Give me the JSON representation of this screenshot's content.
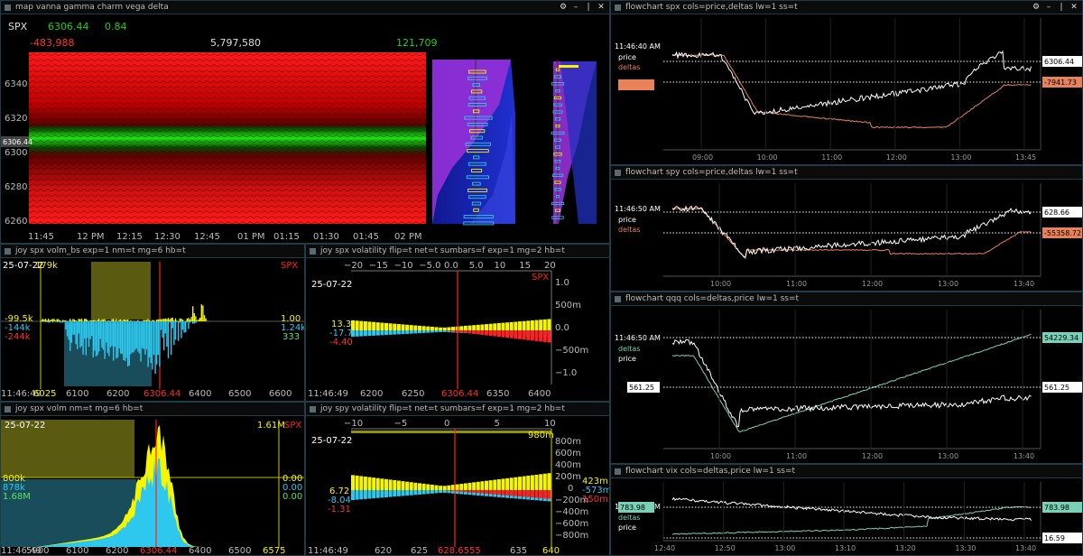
{
  "panels": {
    "map": {
      "title": "map vanna gamma charm vega delta",
      "symbol": "SPX",
      "price": "6306.44",
      "change": "0.84",
      "left_val": "-483,988",
      "mid_val": "5,797,580",
      "right_val": "121,709",
      "current_tag": "6306.44",
      "y_ticks": [
        "6340",
        "6320",
        "6300",
        "6280",
        "6260"
      ],
      "x_ticks": [
        "11:45",
        "12 PM",
        "12:15",
        "12:30",
        "12:45",
        "01 PM",
        "01:15",
        "01:30",
        "01:45",
        "02 PM"
      ]
    },
    "joy1": {
      "title": "joy spx volm_bs exp=1 nm=t mg=6 hb=t",
      "date": "25-07-22",
      "symbol_tag": "SPX",
      "top_val": "179k",
      "left_vals": [
        "-99.5k",
        "-144k",
        "-244k"
      ],
      "right_vals": [
        "1.00",
        "1.24k",
        "333"
      ],
      "time": "11:46:49",
      "left_strike": "6025",
      "cur": "6306.44",
      "x_ticks": [
        "6100",
        "6200",
        "6400",
        "6500",
        "6600"
      ]
    },
    "joy2": {
      "title": "joy spx volatility flip=t net=t sumbars=f exp=1 mg=2 hb=t",
      "date": "25-07-22",
      "symbol_tag": "SPX",
      "top_ticks": [
        "−20",
        "−15",
        "−10",
        "−5.0",
        "0.0",
        "5.0",
        "10",
        "15",
        "20"
      ],
      "right_ticks": [
        "1.0",
        "500m",
        "0.0",
        "−500m",
        "−1.0"
      ],
      "left_vals": [
        "13.3",
        "-17.7",
        "-4.40"
      ],
      "time": "11:46:49",
      "cur": "6306.44",
      "x_ticks": [
        "6200",
        "6250",
        "6350",
        "6400"
      ]
    },
    "joy3": {
      "title": "joy spx volm nm=t mg=6 hb=t",
      "date": "25-07-22",
      "symbol_tag": "SPX",
      "top_val": "1.61M",
      "left_vals": [
        "800k",
        "878k",
        "1.68M"
      ],
      "right_vals": [
        "0.00",
        "0.00",
        "0.00"
      ],
      "time": "11:46:49",
      "right_strike": "6575",
      "cur": "6306.44",
      "x_ticks": [
        "6100",
        "6200",
        "6400",
        "6500"
      ],
      "first_tick": "5900"
    },
    "joy4": {
      "title": "joy spy volatility flip=t net=t sumbars=f exp=1 mg=2 hb=t",
      "date": "25-07-22",
      "top_ticks": [
        "−10",
        "−5",
        "0",
        "5",
        "10"
      ],
      "top_right": "980m",
      "right_ticks": [
        "800m",
        "600m",
        "400m",
        "200m",
        "0",
        "−200m",
        "−400m",
        "−600m",
        "−800m"
      ],
      "left_vals": [
        "6.72",
        "-8.04",
        "-1.31"
      ],
      "right_vals": [
        "423m",
        "-573m",
        "150m"
      ],
      "time": "11:46:49",
      "cur": "628.6555",
      "right_strike": "640",
      "x_ticks": [
        "620",
        "625",
        "635"
      ]
    },
    "fc1": {
      "title": "flowchart spx cols=price,deltas lw=1 ss=t",
      "time": "11:46:40 AM",
      "legend": [
        "price",
        "deltas"
      ],
      "price_tag": "6306.44",
      "delta_tag": "-7941.73",
      "x_ticks": [
        "09:00",
        "10:00",
        "11:00",
        "12:00",
        "13:00",
        "13:45"
      ]
    },
    "fc2": {
      "title": "flowchart spy cols=price,deltas lw=1 ss=t",
      "time": "11:46:50 AM",
      "legend": [
        "price",
        "deltas"
      ],
      "price_tag": "628.66",
      "delta_tag": "-55358.72",
      "x_ticks": [
        "10:00",
        "11:00",
        "12:00",
        "13:00",
        "13:40"
      ]
    },
    "fc3": {
      "title": "flowchart qqq cols=deltas,price lw=1 ss=t",
      "time": "11:46:50 AM",
      "legend": [
        "deltas",
        "price"
      ],
      "delta_tag": "54229.34",
      "price_tag": "561.25",
      "left_tag": "561.25",
      "x_ticks": [
        "10:00",
        "11:00",
        "12:00",
        "13:00",
        "13:40"
      ]
    },
    "fc4": {
      "title": "flowchart vix cols=deltas,price lw=1 ss=t",
      "time": "11:46:40 AM",
      "legend": [
        "deltas",
        "price"
      ],
      "left_tag": "783.98",
      "delta_tag": "783.98",
      "price_tag": "16.59",
      "x_ticks": [
        "12:40",
        "12:50",
        "13:00",
        "13:10",
        "13:20",
        "13:30",
        "13:40"
      ]
    }
  },
  "colors": {
    "red": "#ff2020",
    "green": "#1bd11b",
    "yellow": "#f5f500",
    "cyan": "#2ec8ee",
    "border": "#1e3d47",
    "orange": "#e8825a",
    "teal": "#7bd1b8"
  }
}
